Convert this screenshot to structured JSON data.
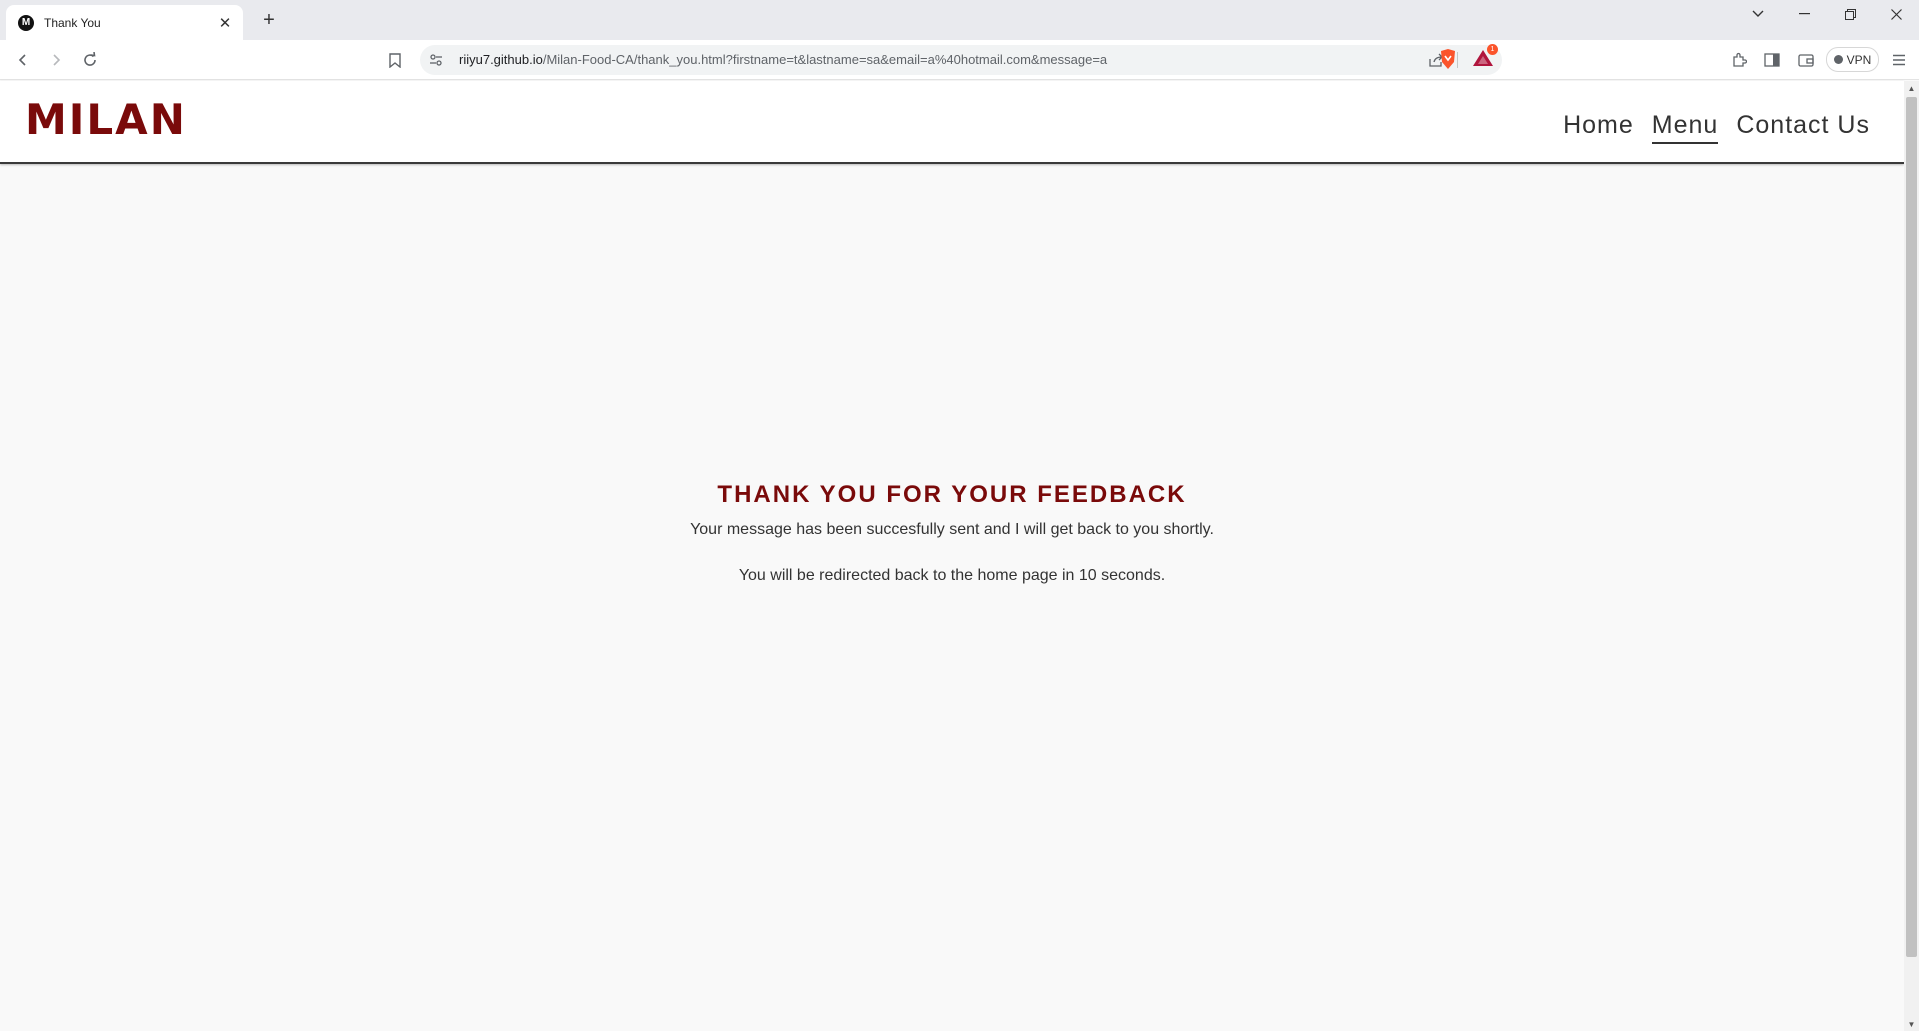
{
  "browser": {
    "tab": {
      "title": "Thank You",
      "favicon_letter": "M"
    },
    "url": {
      "host": "riiyu7.github.io",
      "path": "/Milan-Food-CA/thank_you.html?firstname=t&lastname=sa&email=a%40hotmail.com&message=a"
    },
    "vpn_label": "VPN",
    "rewards_badge": "1"
  },
  "site": {
    "logo": "MILAN",
    "nav": [
      {
        "label": "Home"
      },
      {
        "label": "Menu"
      },
      {
        "label": "Contact Us"
      }
    ]
  },
  "main": {
    "title": "THANK YOU FOR YOUR FEEDBACK",
    "message": "Your message has been succesfully sent and I will get back to you shortly.",
    "redirect": "You will be redirected back to the home page in 10 seconds."
  },
  "colors": {
    "brand": "#7a0a0a",
    "page_bg": "#f9f9f9"
  }
}
